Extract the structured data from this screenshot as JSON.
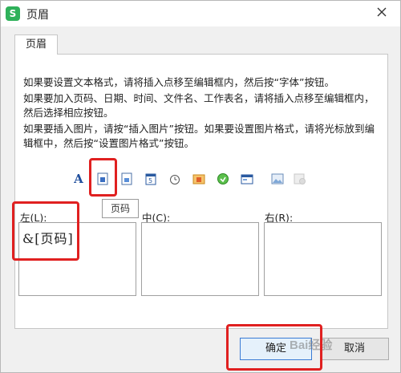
{
  "window": {
    "title": "页眉",
    "app_icon_letter": "S"
  },
  "tabs": [
    {
      "label": "页眉"
    }
  ],
  "instructions": [
    "如果要设置文本格式，请将插入点移至编辑框内，然后按“字体”按钮。",
    "如果要加入页码、日期、时间、文件名、工作表名，请将插入点移至编辑框内，然后选择相应按钮。",
    "如果要插入图片，请按“插入图片”按钮。如果要设置图片格式，请将光标放到编辑框中，然后按“设置图片格式”按钮。"
  ],
  "toolbar": {
    "font_glyph": "A",
    "tooltip": "页码"
  },
  "sections": {
    "left_label": "左(L):",
    "center_label": "中(C):",
    "right_label": "右(R):",
    "left_value": "&[页码]",
    "center_value": "",
    "right_value": ""
  },
  "buttons": {
    "ok": "确定",
    "cancel": "取消"
  },
  "watermark": "Bai经验",
  "colors": {
    "highlight": "#e02020",
    "app_icon": "#2fb15a"
  }
}
